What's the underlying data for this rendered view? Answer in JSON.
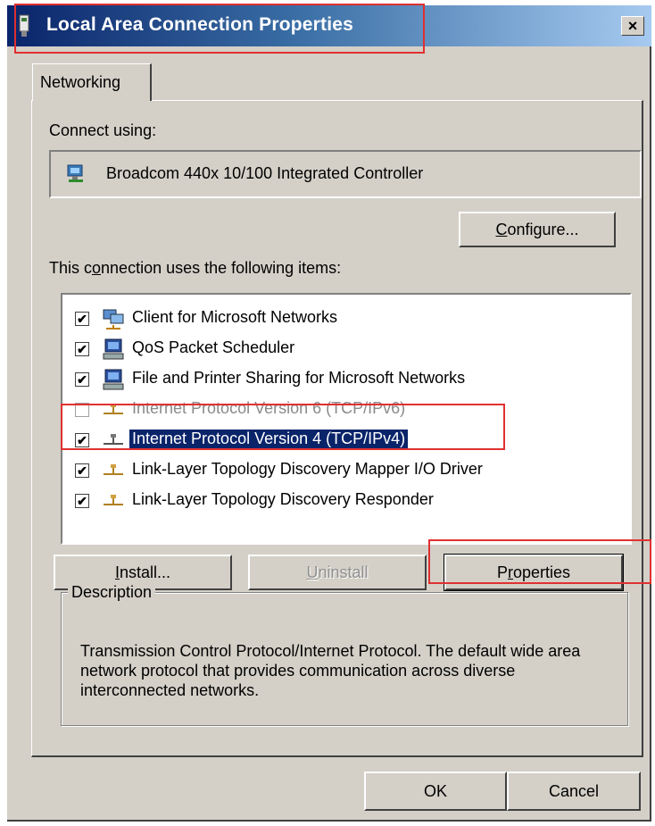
{
  "window": {
    "title": "Local Area Connection Properties",
    "close_label": "×"
  },
  "tabs": [
    {
      "label": "Networking"
    }
  ],
  "connect_using": {
    "label": "Connect using:",
    "adapter": "Broadcom 440x 10/100 Integrated Controller"
  },
  "buttons": {
    "configure": {
      "pre": "",
      "key": "C",
      "post": "onfigure..."
    },
    "install": {
      "pre": "",
      "key": "I",
      "post": "nstall..."
    },
    "uninstall": {
      "pre": "",
      "key": "U",
      "post": "ninstall"
    },
    "properties": {
      "pre": "P",
      "key": "r",
      "post": "operties"
    },
    "ok": "OK",
    "cancel": "Cancel"
  },
  "items_label": {
    "pre": "This c",
    "key": "o",
    "post": "nnection uses the following items:"
  },
  "items": [
    {
      "label": "Client for Microsoft Networks",
      "checked": true,
      "icon": "network-client-icon"
    },
    {
      "label": "QoS Packet Scheduler",
      "checked": true,
      "icon": "computer-icon"
    },
    {
      "label": "File and Printer Sharing for Microsoft Networks",
      "checked": true,
      "icon": "computer-icon"
    },
    {
      "label": "Internet Protocol Version 6 (TCP/IPv6)",
      "checked": false,
      "icon": "protocol-icon"
    },
    {
      "label": "Internet Protocol Version 4 (TCP/IPv4)",
      "checked": true,
      "icon": "protocol-icon",
      "selected": true
    },
    {
      "label": "Link-Layer Topology Discovery Mapper I/O Driver",
      "checked": true,
      "icon": "protocol-icon"
    },
    {
      "label": "Link-Layer Topology Discovery Responder",
      "checked": true,
      "icon": "protocol-icon"
    }
  ],
  "description": {
    "title": "Description",
    "text": "Transmission Control Protocol/Internet Protocol. The default wide area network protocol that provides communication across diverse interconnected networks."
  },
  "check_mark": "✔",
  "colors": {
    "highlight": "#e03030",
    "selection": "#0a246a",
    "face": "#d4d0c8"
  }
}
